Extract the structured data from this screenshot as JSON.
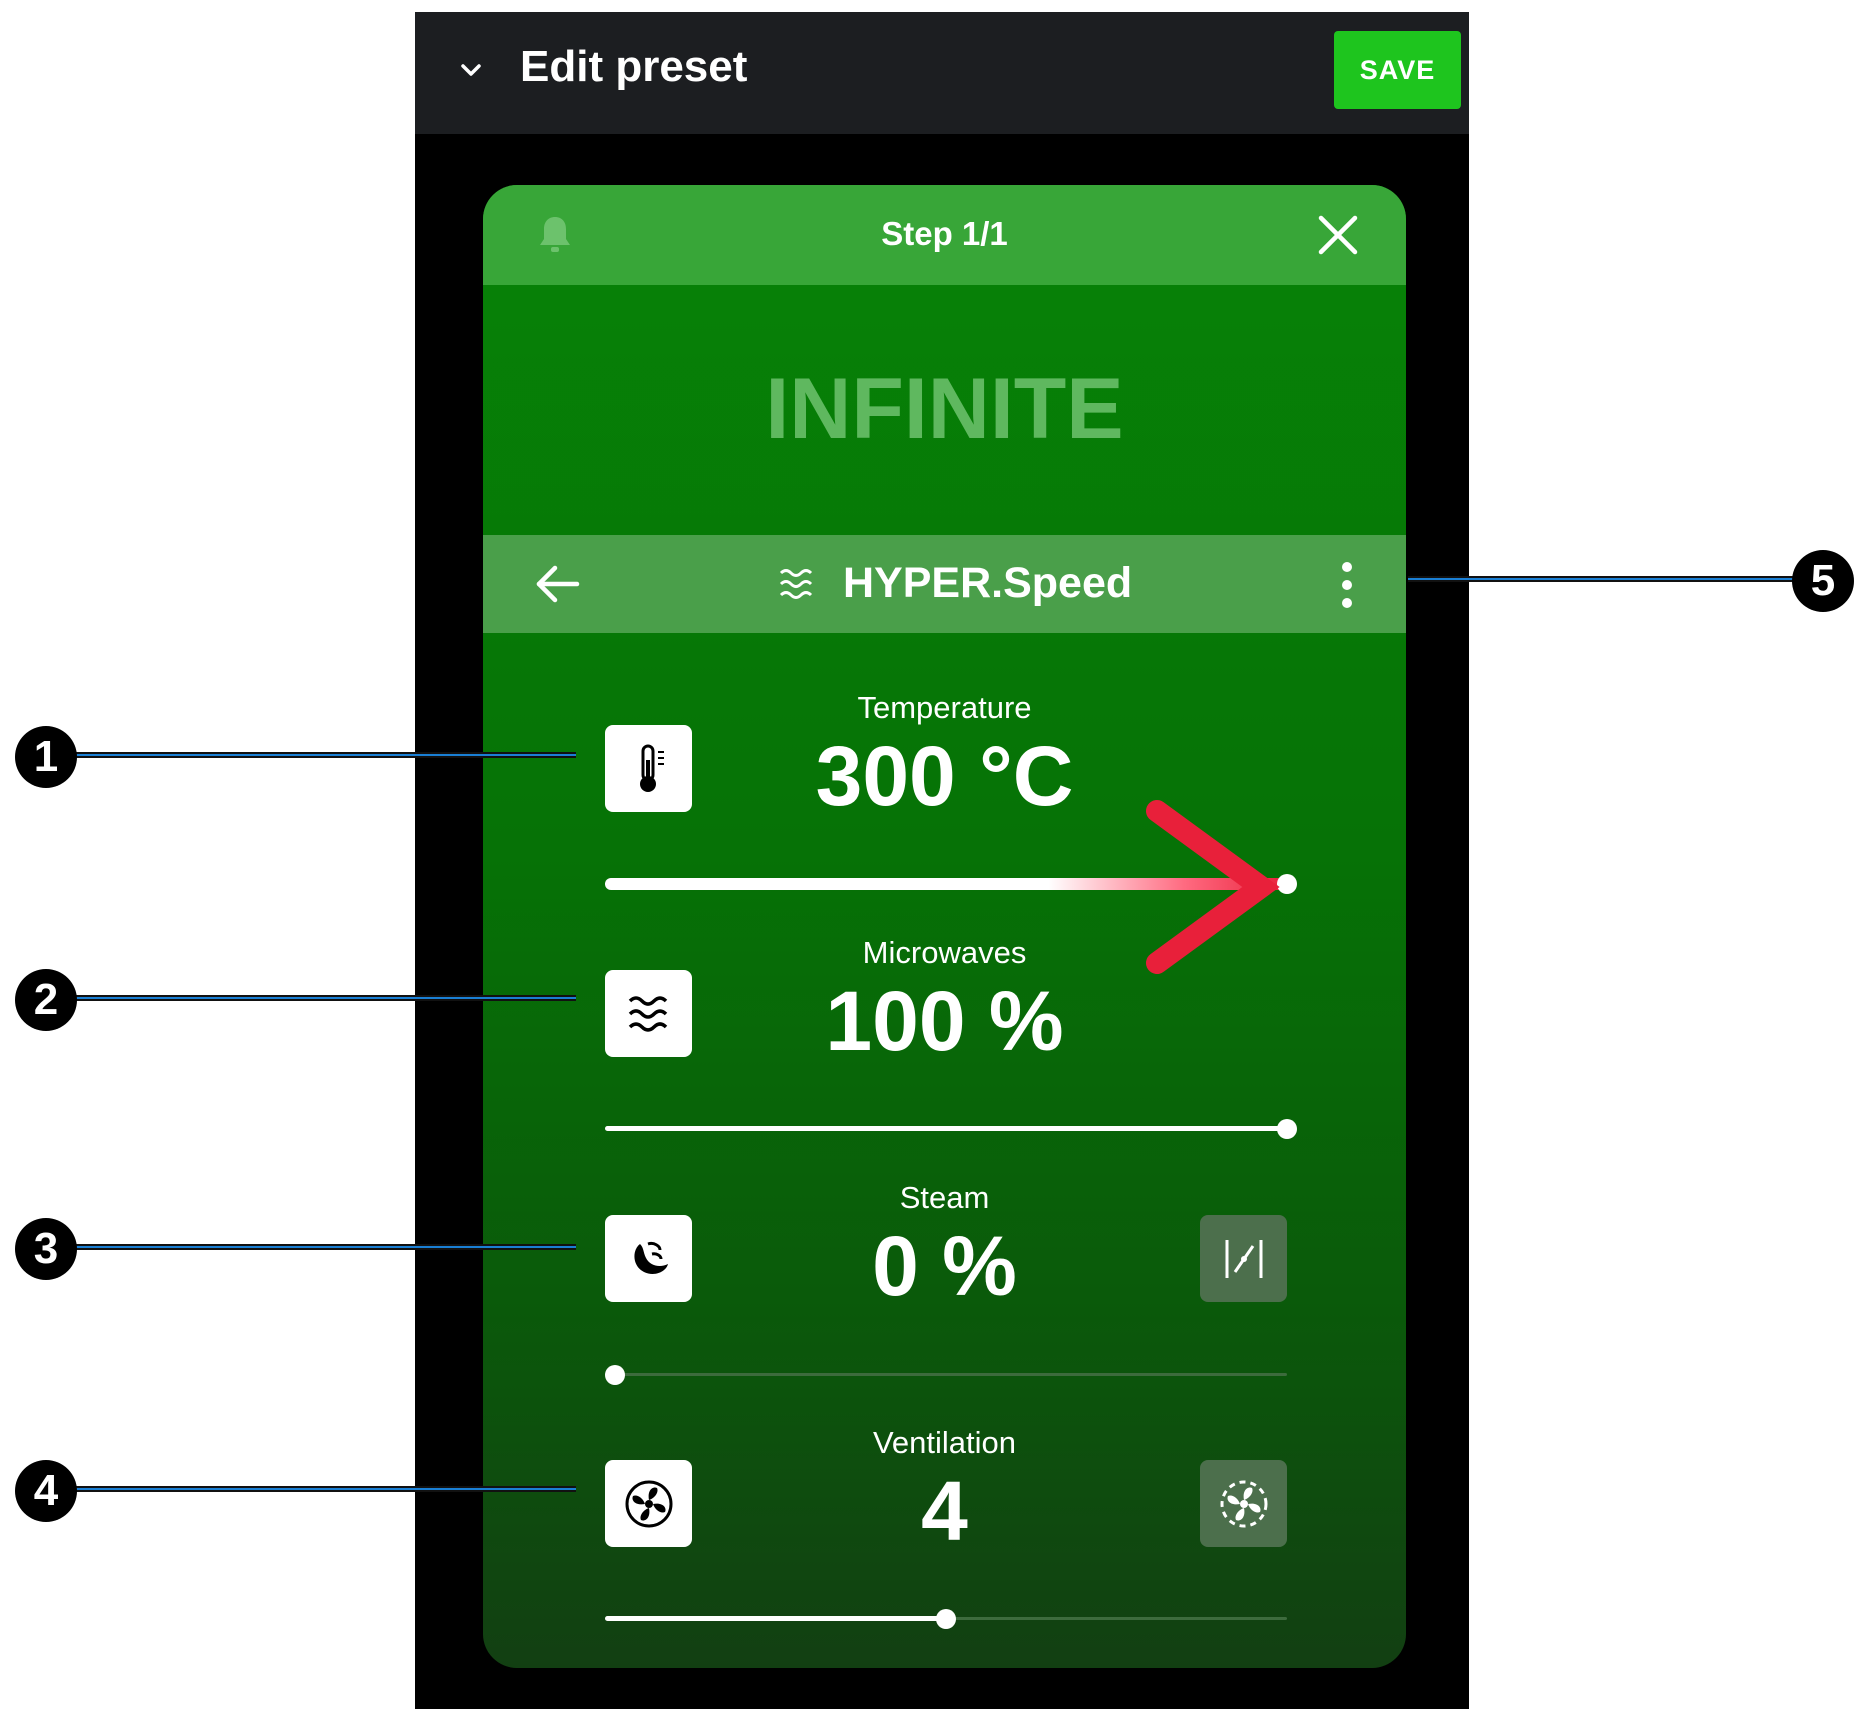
{
  "header": {
    "title": "Edit preset",
    "save_label": "SAVE"
  },
  "card": {
    "step_label": "Step 1/1",
    "duration_text": "INFINITE",
    "mode": {
      "label": "HYPER.Speed",
      "icon": "microwave-waves-icon"
    }
  },
  "params": [
    {
      "label": "Temperature",
      "value": "300 °C",
      "icon": "thermometer-icon",
      "slider_fraction": 1.0
    },
    {
      "label": "Microwaves",
      "value": "100 %",
      "icon": "microwave-waves-icon",
      "slider_fraction": 1.0
    },
    {
      "label": "Steam",
      "value": "0 %",
      "icon": "steam-icon",
      "side_icon": "steam-toggle-icon",
      "slider_fraction": 0.0
    },
    {
      "label": "Ventilation",
      "value": "4",
      "icon": "fan-icon",
      "side_icon": "fan-pulse-icon",
      "slider_fraction": 0.5
    }
  ],
  "callouts": [
    "1",
    "2",
    "3",
    "4",
    "5"
  ],
  "colors": {
    "save_green": "#1ec51e",
    "card_header": "#38a638",
    "mode_bar": "#4a9f4a",
    "arrow_red": "#e8203a"
  }
}
